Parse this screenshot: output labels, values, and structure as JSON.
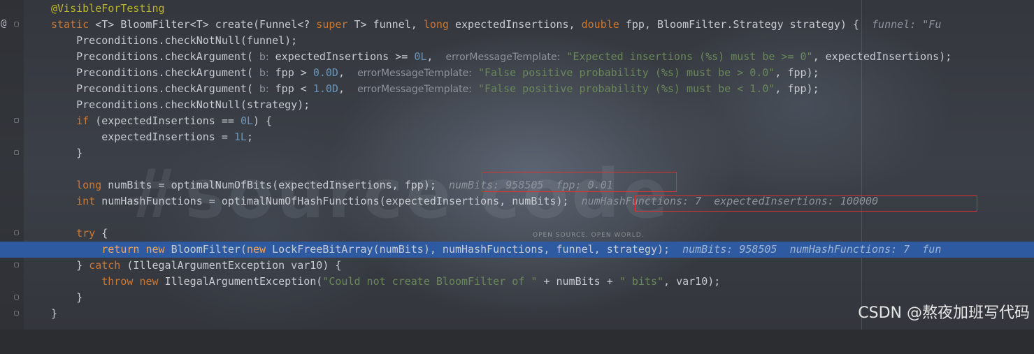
{
  "watermark": {
    "big_text": "#source code",
    "small_text": "OPEN SOURCE. OPEN WORLD.",
    "credit": "CSDN @熬夜加班写代码"
  },
  "colors": {
    "keyword": "#cc7832",
    "number": "#6897bb",
    "string": "#6a8759",
    "annotation": "#bbb529",
    "execution_line": "#2d5aa0",
    "highlight_box": "#e0322d"
  },
  "icons": [
    "at-icon",
    "breakpoint-icon",
    "fold-marker-icon"
  ],
  "code": {
    "l0": "@VisibleForTesting",
    "l1": {
      "static": "static",
      "sig1": " <T> BloomFilter<T> create(Funnel<? ",
      "super": "super",
      "sig2": " T> funnel, ",
      "long": "long",
      "sig3": " expectedInsertions, ",
      "double": "double",
      "sig4": " fpp, BloomFilter.Strategy strategy) {  ",
      "dbg": "funnel: \"Fu"
    },
    "l2": "    Preconditions.checkNotNull(funnel);",
    "l3": {
      "a": "    Preconditions.checkArgument( ",
      "hint_b": "b:",
      "b": " expectedInsertions >= ",
      "num": "0L",
      "c": ",  ",
      "hint_emt": "errorMessageTemplate:",
      "d": " ",
      "str": "\"Expected insertions (%s) must be >= 0\"",
      "e": ", expectedInsertions);"
    },
    "l4": {
      "a": "    Preconditions.checkArgument( ",
      "hint_b": "b:",
      "b": " fpp > ",
      "num": "0.0D",
      "c": ",  ",
      "hint_emt": "errorMessageTemplate:",
      "d": " ",
      "str": "\"False positive probability (%s) must be > 0.0\"",
      "e": ", fpp);"
    },
    "l5": {
      "a": "    Preconditions.checkArgument( ",
      "hint_b": "b:",
      "b": " fpp < ",
      "num": "1.0D",
      "c": ",  ",
      "hint_emt": "errorMessageTemplate:",
      "d": " ",
      "str": "\"False positive probability (%s) must be < 1.0\"",
      "e": ", fpp);"
    },
    "l6": "    Preconditions.checkNotNull(strategy);",
    "l7": {
      "if": "    if",
      "a": " (expectedInsertions == ",
      "num": "0L",
      "b": ") {"
    },
    "l8": {
      "a": "        expectedInsertions = ",
      "num": "1L",
      "b": ";"
    },
    "l9": "    }",
    "l11": {
      "long": "    long",
      "a": " numBits = optimalNumOfBits(expectedInsertions, fpp);  ",
      "dbg": "numBits: 958505  fpp: 0.01"
    },
    "l12": {
      "int": "    int",
      "a": " numHashFunctions = optimalNumOfHashFunctions(expectedInsertions, numBits);  ",
      "dbg": "numHashFunctions: 7  expectedInsertions: 100000"
    },
    "l14": {
      "try": "    try",
      "a": " {"
    },
    "l15": {
      "return": "        return",
      "sp1": " ",
      "new1": "new",
      "a": " BloomFilter(",
      "new2": "new",
      "b": " LockFreeBitArray(numBits), numHashFunctions, funnel, strategy);  ",
      "dbg": "numBits: 958505  numHashFunctions: 7  fun"
    },
    "l16": {
      "a": "    } ",
      "catch": "catch",
      "b": " (IllegalArgumentException var10) {"
    },
    "l17": {
      "throw": "        throw",
      "sp": " ",
      "new": "new",
      "a": " IllegalArgumentException(",
      "str1": "\"Could not create BloomFilter of \"",
      "b": " + numBits + ",
      "str2": "\" bits\"",
      "c": ", var10);"
    },
    "l18": "    }",
    "l19": "}"
  }
}
